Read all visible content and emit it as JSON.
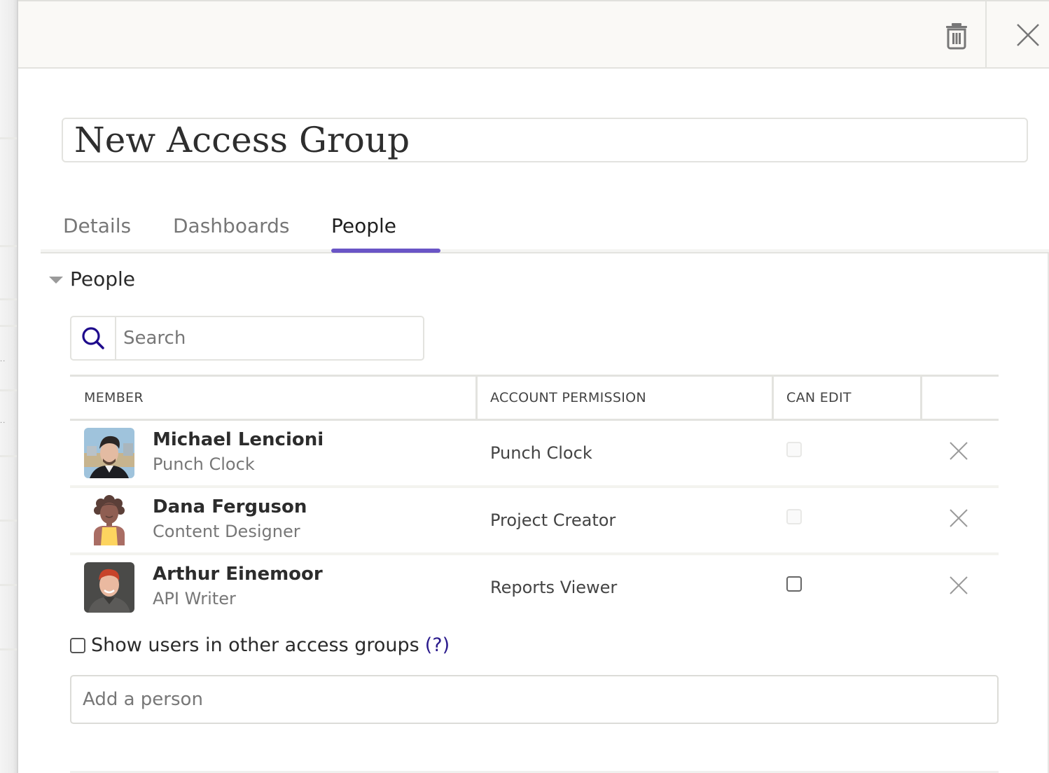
{
  "header": {
    "delete_icon": "trash-icon",
    "close_icon": "close-icon"
  },
  "title": {
    "value": "New Access Group"
  },
  "tabs": [
    {
      "label": "Details",
      "active": false
    },
    {
      "label": "Dashboards",
      "active": false
    },
    {
      "label": "People",
      "active": true
    }
  ],
  "accent_color": "#6a55c6",
  "section": {
    "title": "People",
    "expanded": true
  },
  "search": {
    "placeholder": "Search",
    "value": ""
  },
  "table": {
    "columns": [
      "MEMBER",
      "ACCOUNT PERMISSION",
      "CAN EDIT",
      ""
    ],
    "rows": [
      {
        "name": "Michael Lencioni",
        "role": "Punch Clock",
        "permission": "Punch Clock",
        "can_edit": false,
        "can_edit_enabled": false,
        "avatar": "photo-man-dark-hair"
      },
      {
        "name": "Dana Ferguson",
        "role": "Content Designer",
        "permission": "Project Creator",
        "can_edit": false,
        "can_edit_enabled": false,
        "avatar": "illustration-woman-curly-hair"
      },
      {
        "name": "Arthur Einemoor",
        "role": "API Writer",
        "permission": "Reports Viewer",
        "can_edit": false,
        "can_edit_enabled": true,
        "avatar": "photo-person-red-hair"
      }
    ]
  },
  "show_users": {
    "label": "Show users in other access groups",
    "help_label": "(?)",
    "checked": false
  },
  "add_person": {
    "placeholder": "Add a person",
    "value": ""
  }
}
